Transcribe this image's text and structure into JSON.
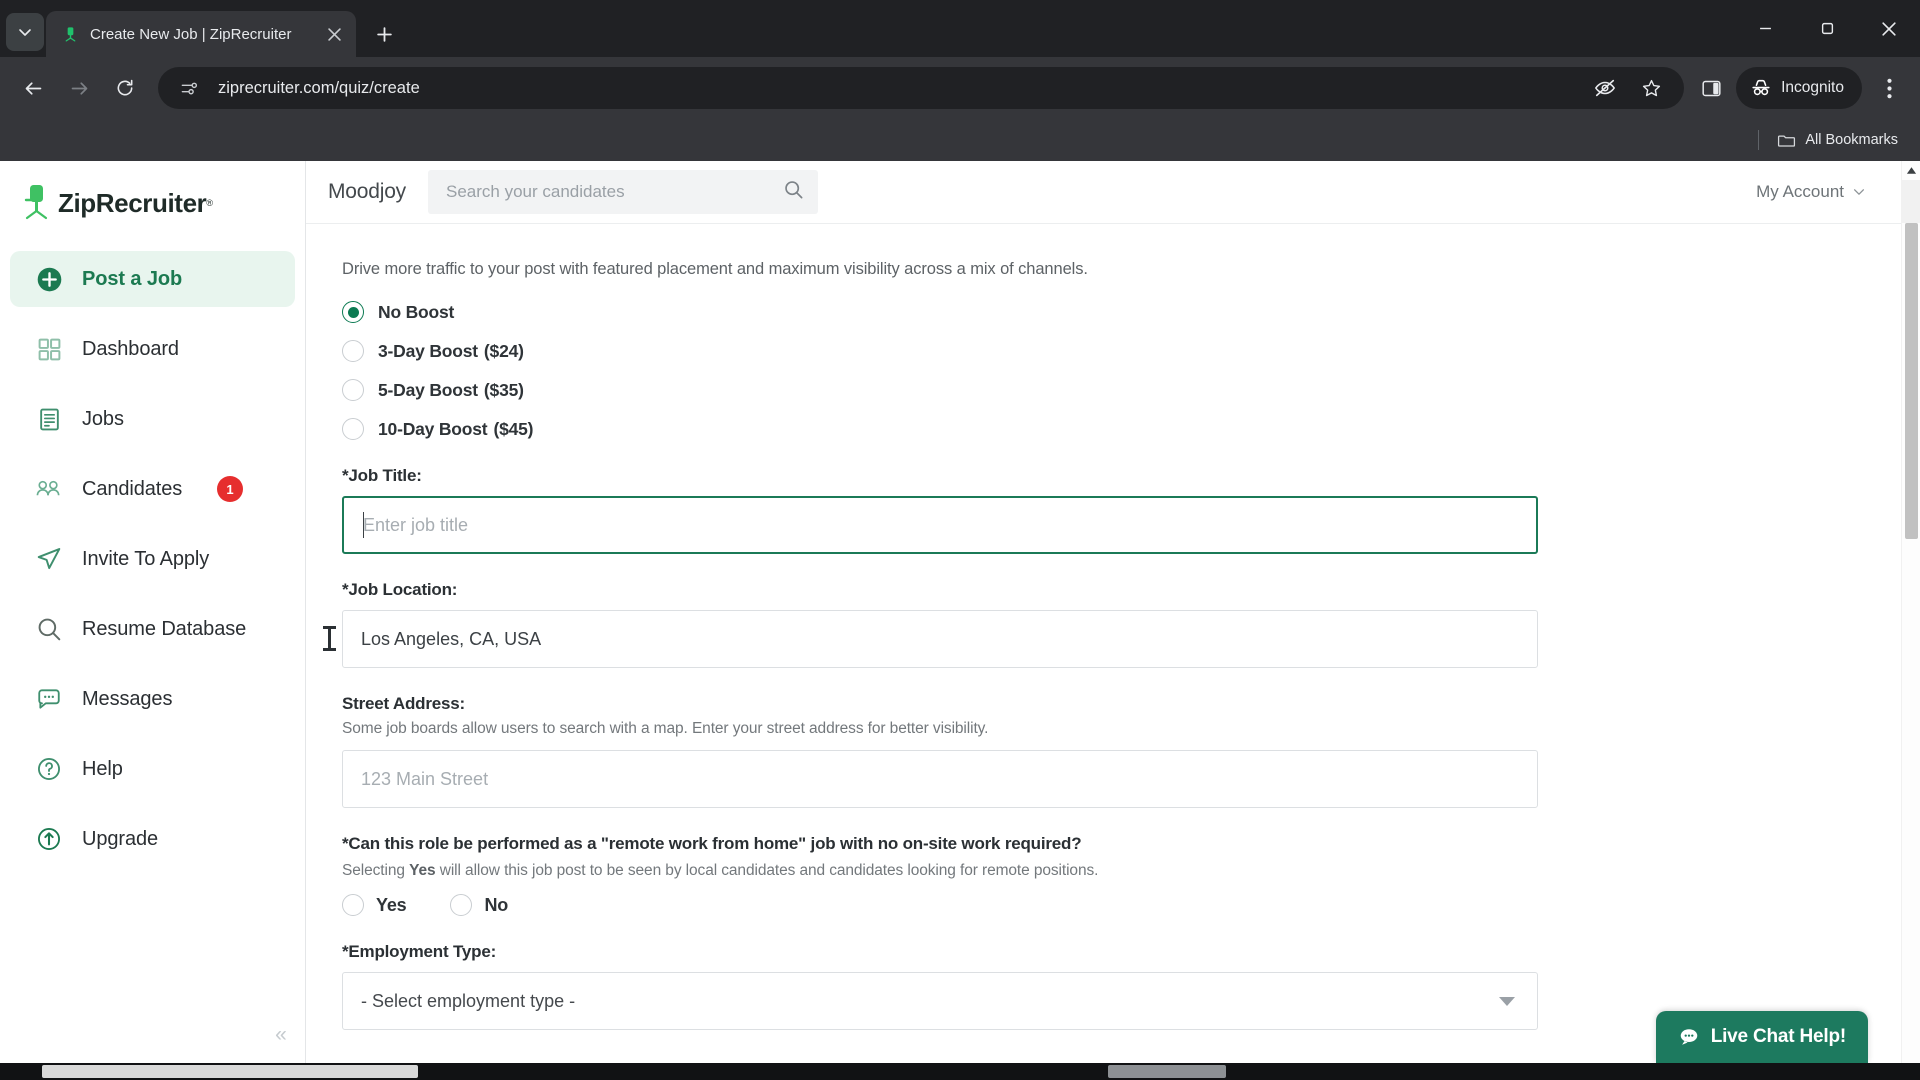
{
  "browser": {
    "tab": {
      "title": "Create New Job | ZipRecruiter",
      "favicon_name": "ziprecruiter-favicon",
      "close_label": "×"
    },
    "new_tab_label": "+",
    "tab_search_name": "tab-search-chevron",
    "url": "ziprecruiter.com/quiz/create",
    "incognito_label": "Incognito",
    "bookmarks_label": "All Bookmarks",
    "window": {
      "minimize": "—",
      "maximize": "❐",
      "close": "✕"
    }
  },
  "sidebar": {
    "logo_text": "ZipRecruiter",
    "logo_tm": "®",
    "items": [
      {
        "label": "Post a Job",
        "icon": "plus-circle-icon",
        "active": true,
        "badge": ""
      },
      {
        "label": "Dashboard",
        "icon": "grid-icon",
        "active": false,
        "badge": ""
      },
      {
        "label": "Jobs",
        "icon": "document-icon",
        "active": false,
        "badge": ""
      },
      {
        "label": "Candidates",
        "icon": "people-icon",
        "active": false,
        "badge": "1"
      },
      {
        "label": "Invite To Apply",
        "icon": "paper-plane-icon",
        "active": false,
        "badge": ""
      },
      {
        "label": "Resume Database",
        "icon": "search-icon",
        "active": false,
        "badge": ""
      },
      {
        "label": "Messages",
        "icon": "chat-bubble-icon",
        "active": false,
        "badge": ""
      },
      {
        "label": "Help",
        "icon": "question-circle-icon",
        "active": false,
        "badge": ""
      },
      {
        "label": "Upgrade",
        "icon": "upgrade-arrow-icon",
        "active": false,
        "badge": ""
      }
    ],
    "collapse_label": "«"
  },
  "header": {
    "brand": "Moodjoy",
    "search_placeholder": "Search your candidates",
    "search_value": "",
    "account_label": "My Account",
    "account_caret": "⌄"
  },
  "form": {
    "boost_lead": "Drive more traffic to your post with featured placement and maximum visibility across a mix of channels.",
    "boost_options": [
      {
        "label": "No Boost",
        "price": "",
        "selected": true
      },
      {
        "label": "3-Day Boost",
        "price": "($24)",
        "selected": false
      },
      {
        "label": "5-Day Boost",
        "price": "($35)",
        "selected": false
      },
      {
        "label": "10-Day Boost",
        "price": "($45)",
        "selected": false
      }
    ],
    "job_title": {
      "label": "*Job Title:",
      "placeholder": "Enter job title",
      "value": "",
      "focused": true
    },
    "job_location": {
      "label": "*Job Location:",
      "value": "Los Angeles, CA, USA",
      "placeholder": ""
    },
    "street_address": {
      "label": "Street Address:",
      "hint": "Some job boards allow users to search with a map. Enter your street address for better visibility.",
      "placeholder": "123 Main Street",
      "value": ""
    },
    "remote": {
      "question": "*Can this role be performed as a \"remote work from home\" job with no on-site work required?",
      "hint_prefix": "Selecting ",
      "hint_bold": "Yes",
      "hint_suffix": " will allow this job post to be seen by local candidates and candidates looking for remote positions.",
      "yes_label": "Yes",
      "no_label": "No",
      "selected": ""
    },
    "employment_type": {
      "label": "*Employment Type:",
      "value": "- Select employment type -"
    }
  },
  "livechat": {
    "label": "Live Chat Help!",
    "icon": "chat-icon"
  },
  "colors": {
    "brand_green": "#1d7a5f",
    "accent_green": "#0c7a52",
    "badge_red": "#e62e2e",
    "chrome_dark": "#202124",
    "chrome_toolbar": "#35363a"
  }
}
